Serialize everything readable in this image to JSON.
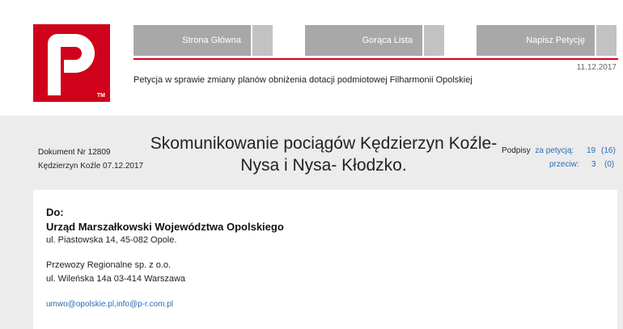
{
  "nav": {
    "home": "Strona Główna",
    "hot": "Gorąca Lista",
    "write": "Napisz Petycję"
  },
  "date_top": "11.12.2017",
  "subtitle": "Petycja w sprawie zmiany planów obniżenia dotacji podmiotowej Filharmonii Opolskiej",
  "logo": {
    "tm": "TM",
    "color": "#d0021b"
  },
  "document": {
    "number": "Dokument Nr 12809",
    "place_date": "Kędzierzyn Koźle 07.12.2017",
    "title": "Skomunikowanie pociągów Kędzierzyn Koźle- Nysa i Nysa- Kłodzko."
  },
  "votes": {
    "label": "Podpisy",
    "for_label": "za petycją:",
    "for_count": "19",
    "for_total": "(16)",
    "against_label": "przeciw:",
    "against_count": "3",
    "against_total": "(0)"
  },
  "recipient": {
    "do_label": "Do:",
    "org": "Urząd Marszałkowski Województwa Opolskiego",
    "address": "ul. Piastowska 14, 45-082 Opole.",
    "company": "Przewozy Regionalne sp. z o.o.",
    "company_address": "ul. Wileńska 14a 03-414 Warszawa",
    "emails": "umwo@opolskie.pl,info@p-r.com.pl"
  }
}
